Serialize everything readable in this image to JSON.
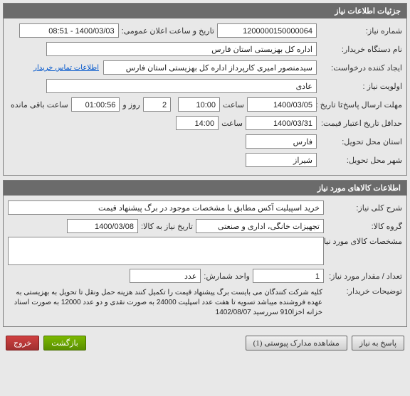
{
  "panel1": {
    "title": "جزئیات اطلاعات نیاز",
    "requestNumberLabel": "شماره نیاز:",
    "requestNumber": "1200000150000064",
    "publicDateTimeLabel": "تاریخ و ساعت اعلان عمومی:",
    "publicDateTime": "1400/03/03 - 08:51",
    "buyerNameLabel": "نام دستگاه خریدار:",
    "buyerName": "اداره کل بهزیستی استان فارس",
    "requesterLabel": "ایجاد کننده درخواست:",
    "requester": "سیدمنصور امیری کارپرداز اداره کل بهزیستی استان فارس",
    "contactLink": "اطلاعات تماس خریدار",
    "priorityLabel": "اولویت نیاز :",
    "priority": "عادی",
    "deadlineLabel": "مهلت ارسال پاسخ:",
    "toDateLabel": "تا تاریخ :",
    "deadlineDate": "1400/03/05",
    "timeLabel": "ساعت",
    "deadlineTime": "10:00",
    "daysValue": "2",
    "daysLabel": "روز و",
    "remainingTime": "01:00:56",
    "remainingLabel": "ساعت باقی مانده",
    "minValidityLabel": "حداقل تاریخ اعتبار قیمت:",
    "minValidityDate": "1400/03/31",
    "minValidityTime": "14:00",
    "deliveryProvinceLabel": "استان محل تحویل:",
    "deliveryProvince": "فارس",
    "deliveryCityLabel": "شهر محل تحویل:",
    "deliveryCity": "شیراز"
  },
  "panel2": {
    "title": "اطلاعات کالاهای مورد نیاز",
    "descLabel": "شرح کلی نیاز:",
    "desc": "خرید اسپیلیت آکس مطابق با مشخصات موجود در برگ پیشنهاد قیمت",
    "groupLabel": "گروه کالا:",
    "group": "تجهیزات خانگی، اداری و صنعتی",
    "neededByLabel": "تاریخ نیاز به کالا:",
    "neededByDate": "1400/03/08",
    "specsLabel": "مشخصات کالای مورد نیاز:",
    "specs": "",
    "qtyLabel": "تعداد / مقدار مورد نیاز:",
    "qty": "1",
    "unitLabel": "واحد شمارش:",
    "unit": "عدد",
    "notesLabel": "توضیحات خریدار:",
    "notes": "کلیه شرکت کنندگان می بایست برگ پیشنهاد قیمت را تکمیل کنند\nهزینه حمل ونقل تا تحویل به بهزیستی به عهده فروشنده میباشد\nتسویه تا هفت عدد اسپلیت 24000 به صورت نقدی و دو عدد 12000 به صورت اسناد خزانه اخزا910 سررسید 1402/08/07"
  },
  "buttons": {
    "reply": "پاسخ به نیاز",
    "attachments": "مشاهده مدارک پیوستی (1)",
    "back": "بازگشت",
    "exit": "خروج"
  }
}
